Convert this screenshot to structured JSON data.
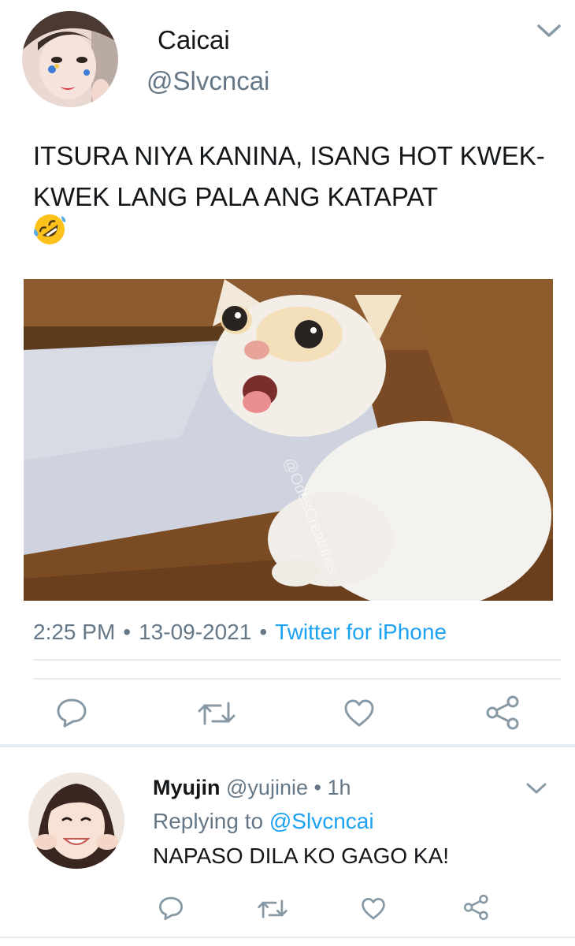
{
  "tweet": {
    "author": {
      "name": "Caicai",
      "handle": "@Slvcncai",
      "avatar": "avatar-photo"
    },
    "text": "ITSURA NIYA KANINA, ISANG HOT KWEK-KWEK LANG PALA ANG KATAPAT",
    "emoji": "rolling-on-floor-laughing-icon",
    "media": {
      "kind": "photo",
      "subject": "cat-photo",
      "watermark": "@OdesCreatures"
    },
    "time": "2:25 PM",
    "date": "13-09-2021",
    "separator": "•",
    "source": "Twitter for iPhone",
    "actions": [
      "reply-icon",
      "retweet-icon",
      "like-icon",
      "share-icon"
    ]
  },
  "reply": {
    "author": {
      "name": "Myujin",
      "handle": "@yujinie",
      "avatar": "avatar-photo"
    },
    "separator": "•",
    "time": "1h",
    "replying_to_label": "Replying to ",
    "replying_to_handle": "@Slvcncai",
    "text": "NAPASO DILA KO GAGO KA!",
    "actions": [
      "reply-icon",
      "retweet-icon",
      "like-icon",
      "share-icon"
    ]
  },
  "colors": {
    "text_primary": "#14171a",
    "text_secondary": "#657786",
    "accent": "#1da1f2",
    "icon": "#8899a6",
    "divider": "#e6ecf0"
  }
}
